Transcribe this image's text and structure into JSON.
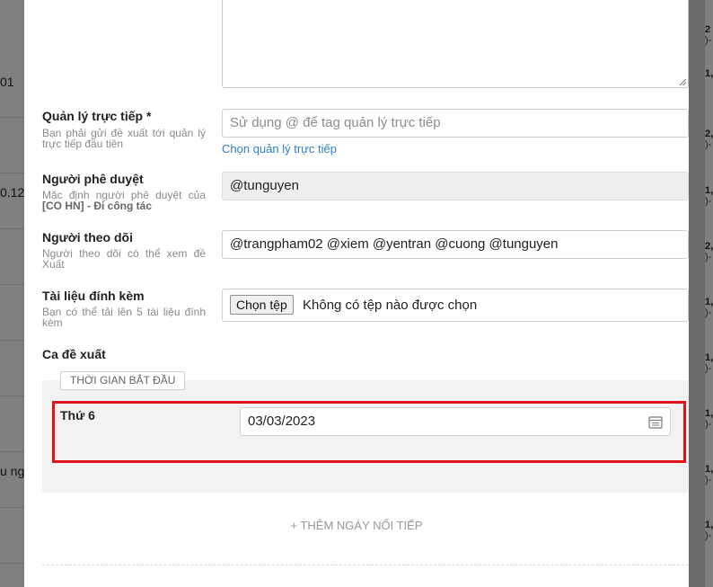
{
  "background": {
    "left_fragments": [
      "01",
      "0.12",
      "u ngà"
    ],
    "right_fragments": [
      {
        "top": "2",
        "bottom": ")-"
      },
      {
        "top": "1,",
        "bottom": ""
      },
      {
        "top": "2,",
        "bottom": ")-"
      },
      {
        "top": "1,",
        "bottom": ")-"
      },
      {
        "top": "2,",
        "bottom": ")-"
      },
      {
        "top": "1,",
        "bottom": ")-"
      },
      {
        "top": "1,",
        "bottom": ")-"
      },
      {
        "top": "1,",
        "bottom": ")-"
      },
      {
        "top": "1,",
        "bottom": ")-"
      },
      {
        "top": "1,",
        "bottom": ")-"
      }
    ]
  },
  "form": {
    "direct_manager": {
      "label": "Quản lý trực tiếp *",
      "hint": "Bạn phải gửi đề xuất tới quản lý trực tiếp đầu tiên",
      "placeholder": "Sử dụng @ để tag quản lý trực tiếp",
      "link": "Chọn quản lý trực tiếp"
    },
    "approver": {
      "label": "Người phê duyệt",
      "hint_prefix": "Mặc định người phê duyệt của ",
      "hint_bold": "[CO HN] - Đi công tác",
      "value": "@tunguyen"
    },
    "followers": {
      "label": "Người theo dõi",
      "hint": "Người theo dõi có thể xem đề Xuất",
      "value": "@trangpham02 @xiem @yentran @cuong @tunguyen"
    },
    "attachments": {
      "label": "Tài liệu đính kèm",
      "hint": "Bạn có thể tải lên 5 tài liệu đính kèm",
      "button": "Chọn tệp",
      "status": "Không có tệp nào được chọn"
    },
    "shift": {
      "label": "Ca đề xuất",
      "start_badge": "THỜI GIAN BẮT ĐẦU",
      "day_label": "Thứ 6",
      "date_value": "03/03/2023",
      "add_day": "+ THÊM NGÀY NỐI TIẾP"
    }
  },
  "colors": {
    "link": "#2f7ec8",
    "highlight": "#e0131b"
  }
}
